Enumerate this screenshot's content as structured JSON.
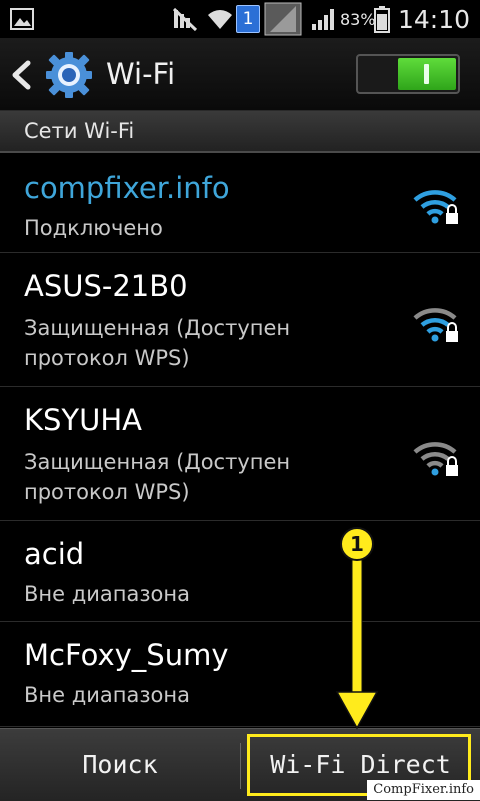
{
  "status_bar": {
    "battery_percent": "83%",
    "time": "14:10",
    "notification_count": "1",
    "icons": [
      "image-notification-icon",
      "mute-icon",
      "wifi-status-icon",
      "notification-badge-icon",
      "no-signal-icon",
      "cell-signal-icon",
      "battery-icon"
    ]
  },
  "action_bar": {
    "title": "Wi-Fi",
    "toggle_state": "on",
    "icons": [
      "back-icon",
      "settings-gear-icon"
    ]
  },
  "section_header": "Сети Wi-Fi",
  "networks": [
    {
      "name": "compfixer.info",
      "status": "Подключено",
      "connected": true,
      "signal": "full",
      "secured": true
    },
    {
      "name": "ASUS-21B0",
      "status": "Защищенная (Доступен протокол WPS)",
      "connected": false,
      "signal": "medium",
      "secured": true
    },
    {
      "name": "KSYUHA",
      "status": "Защищенная (Доступен протокол WPS)",
      "connected": false,
      "signal": "low",
      "secured": true
    },
    {
      "name": "acid",
      "status": "Вне диапазона",
      "connected": false
    },
    {
      "name": "McFoxy_Sumy",
      "status": "Вне диапазона",
      "connected": false
    }
  ],
  "bottom_bar": {
    "search_label": "Поиск",
    "wifi_direct_label": "Wi-Fi Direct"
  },
  "annotation": {
    "step_number": "1"
  },
  "watermark": "CompFixer.info",
  "colors": {
    "connected_network": "#3fa6da",
    "toggle_on": "#4cc72a",
    "annotation": "#ffeb1c",
    "wifi_signal_active": "#2f9fe0",
    "wifi_signal_inactive": "#8a8a8a"
  }
}
